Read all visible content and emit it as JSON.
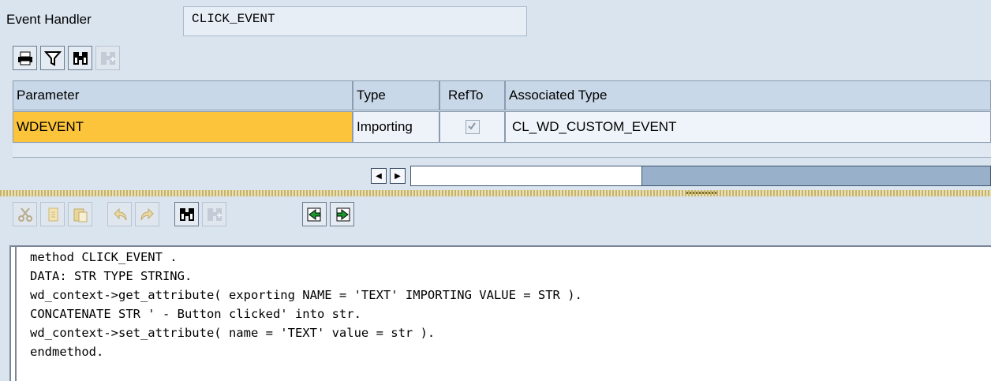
{
  "header": {
    "label": "Event Handler",
    "value": "CLICK_EVENT"
  },
  "param_toolbar": {
    "icons": [
      "print-icon",
      "filter-icon",
      "find-icon",
      "find-next-icon"
    ]
  },
  "table": {
    "headers": {
      "parameter": "Parameter",
      "type": "Type",
      "refto": "RefTo",
      "assoc": "Associated Type"
    },
    "rows": [
      {
        "parameter": "WDEVENT",
        "type": "Importing",
        "refto_checked": true,
        "assoc": "CL_WD_CUSTOM_EVENT"
      }
    ]
  },
  "editor_toolbar": {
    "icons": [
      "cut-icon",
      "copy-icon",
      "paste-icon",
      "undo-icon",
      "redo-icon",
      "find-icon",
      "find-next-icon",
      "upload-icon",
      "download-icon"
    ]
  },
  "code": {
    "lines": [
      "method CLICK_EVENT .",
      "DATA: STR TYPE STRING.",
      "wd_context->get_attribute( exporting NAME = 'TEXT' IMPORTING VALUE = STR ).",
      "CONCATENATE STR ' - Button clicked' into str.",
      "wd_context->set_attribute( name = 'TEXT' value = str ).",
      "endmethod."
    ]
  }
}
